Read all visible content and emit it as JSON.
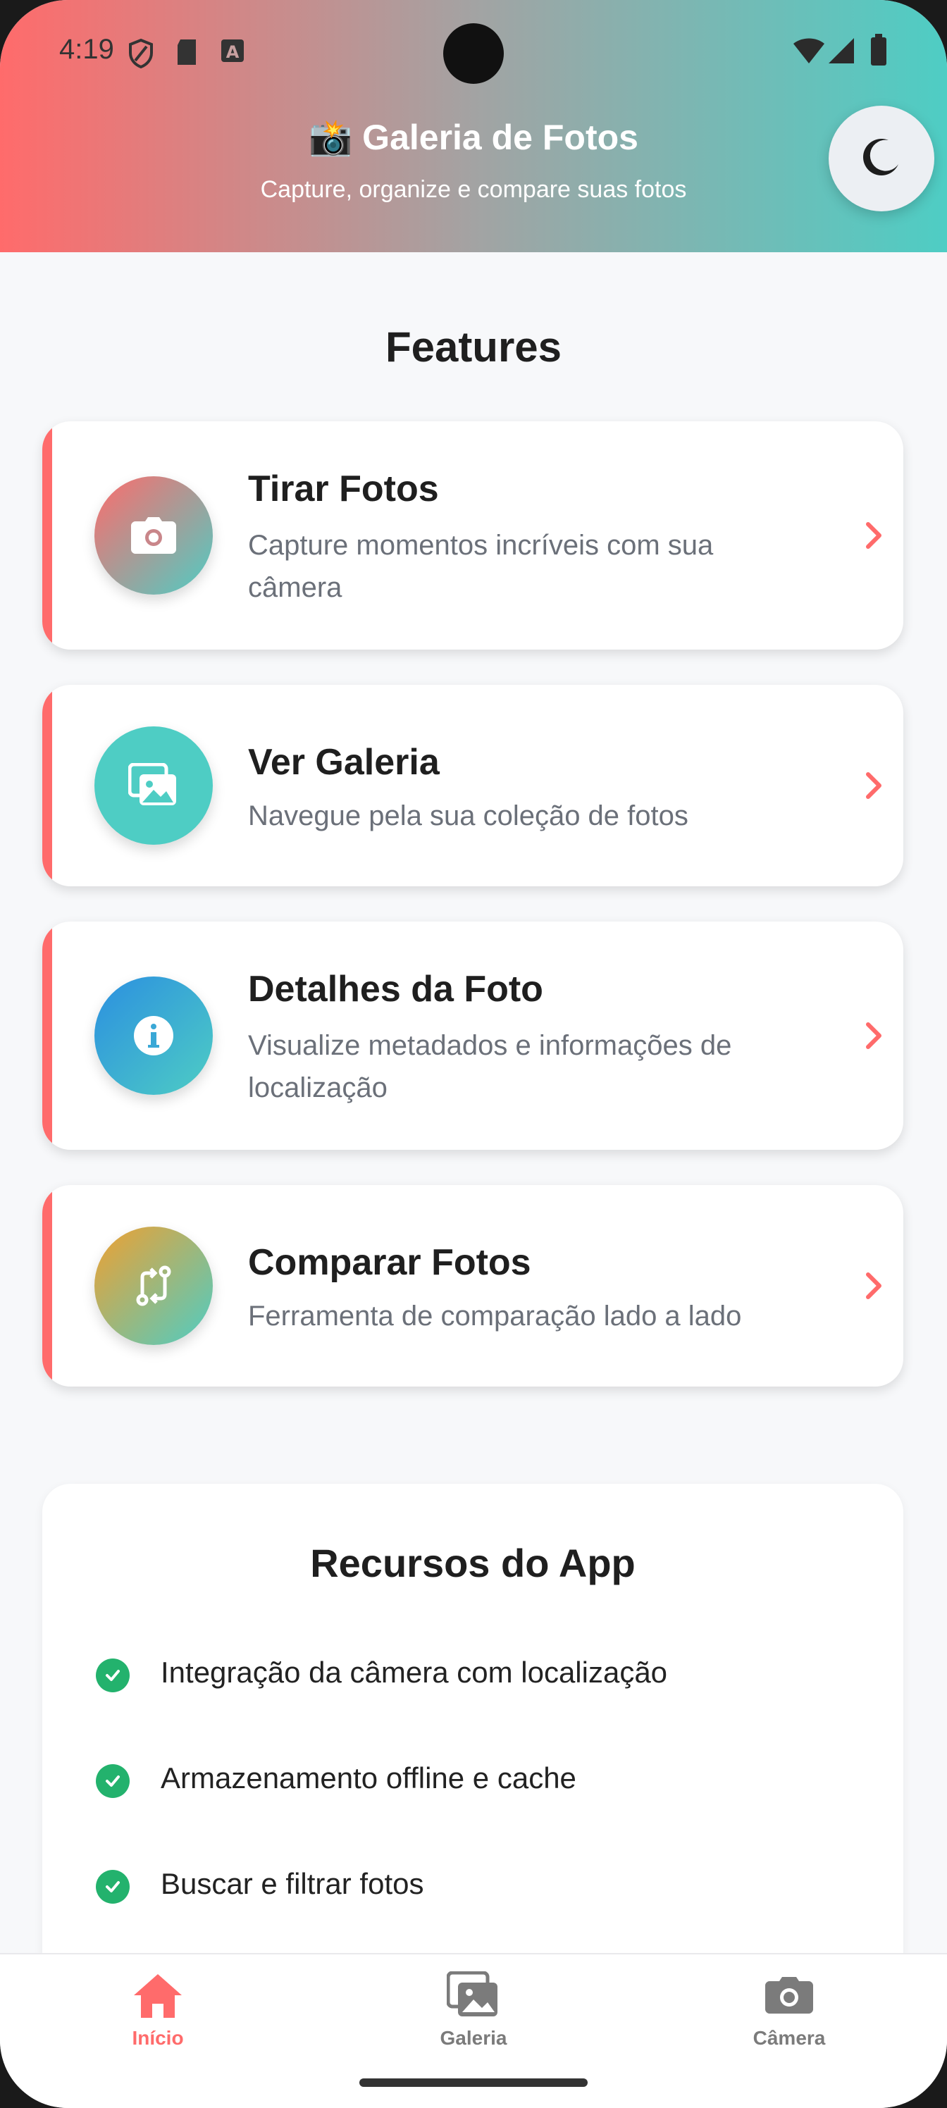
{
  "status_bar": {
    "time": "4:19"
  },
  "header": {
    "title": "📸 Galeria de Fotos",
    "subtitle": "Capture, organize e compare suas fotos",
    "theme_toggle_icon": "moon-icon"
  },
  "features": {
    "title": "Features",
    "items": [
      {
        "title": "Tirar Fotos",
        "description": "Capture momentos incríveis com sua câmera",
        "icon": "camera-icon"
      },
      {
        "title": "Ver Galeria",
        "description": "Navegue pela sua coleção de fotos",
        "icon": "images-icon"
      },
      {
        "title": "Detalhes da Foto",
        "description": "Visualize metadados e informações de localização",
        "icon": "info-icon"
      },
      {
        "title": "Comparar Fotos",
        "description": "Ferramenta de comparação lado a lado",
        "icon": "compare-icon"
      }
    ]
  },
  "resources": {
    "title": "Recursos do App",
    "items": [
      "Integração da câmera com localização",
      "Armazenamento offline e cache",
      "Buscar e filtrar fotos"
    ]
  },
  "bottom_nav": {
    "items": [
      {
        "label": "Início",
        "icon": "home-icon",
        "active": true
      },
      {
        "label": "Galeria",
        "icon": "gallery-icon",
        "active": false
      },
      {
        "label": "Câmera",
        "icon": "camera-icon",
        "active": false
      }
    ]
  },
  "colors": {
    "accent": "#ff6b6b",
    "teal": "#4ecdc4",
    "check": "#23b26d",
    "text_muted": "#6b7079"
  }
}
